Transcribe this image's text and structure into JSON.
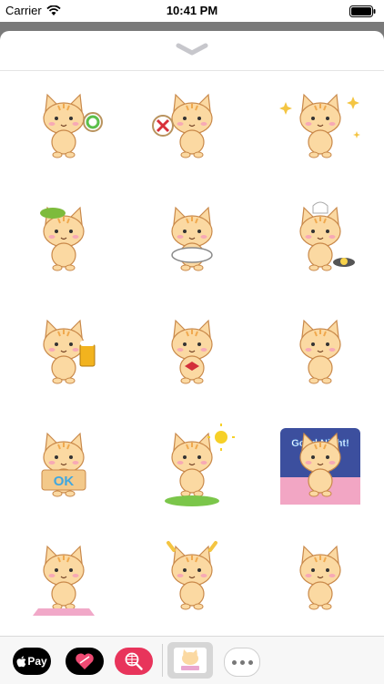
{
  "status": {
    "carrier": "Carrier",
    "time": "10:41 PM"
  },
  "stickers": [
    {
      "name": "cat-ok-sign-sticker",
      "prop": "ok-sign"
    },
    {
      "name": "cat-x-sign-sticker",
      "prop": "x-sign"
    },
    {
      "name": "cat-sparkle-sticker",
      "prop": "sparkles"
    },
    {
      "name": "cat-green-cap-sticker",
      "prop": "green-cap"
    },
    {
      "name": "cat-eating-bowl-sticker",
      "prop": "bowl"
    },
    {
      "name": "cat-chef-pan-sticker",
      "prop": "chef-pan"
    },
    {
      "name": "cat-beer-sticker",
      "prop": "beer"
    },
    {
      "name": "cat-bow-sticker",
      "prop": "bow"
    },
    {
      "name": "cat-walking-sticker",
      "prop": "walk"
    },
    {
      "name": "cat-ok-board-sticker",
      "prop": "ok-board",
      "text": "OK"
    },
    {
      "name": "cat-toast-sun-sticker",
      "prop": "sun"
    },
    {
      "name": "cat-good-night-sticker",
      "prop": "night",
      "text": "Good Night!"
    },
    {
      "name": "cat-crying-pillow-sticker",
      "prop": "pillow"
    },
    {
      "name": "cat-shocked-sticker",
      "prop": "shocked"
    },
    {
      "name": "cat-laughing-sticker",
      "prop": "laugh"
    }
  ],
  "drawer": {
    "applepay_label": "Pay",
    "applepay_logo": "apple-icon"
  },
  "colors": {
    "cat_fur": "#fbd9a2",
    "cat_stripe": "#f0a94e",
    "cat_outline": "#c9894a",
    "accent_pink": "#e8345b"
  }
}
